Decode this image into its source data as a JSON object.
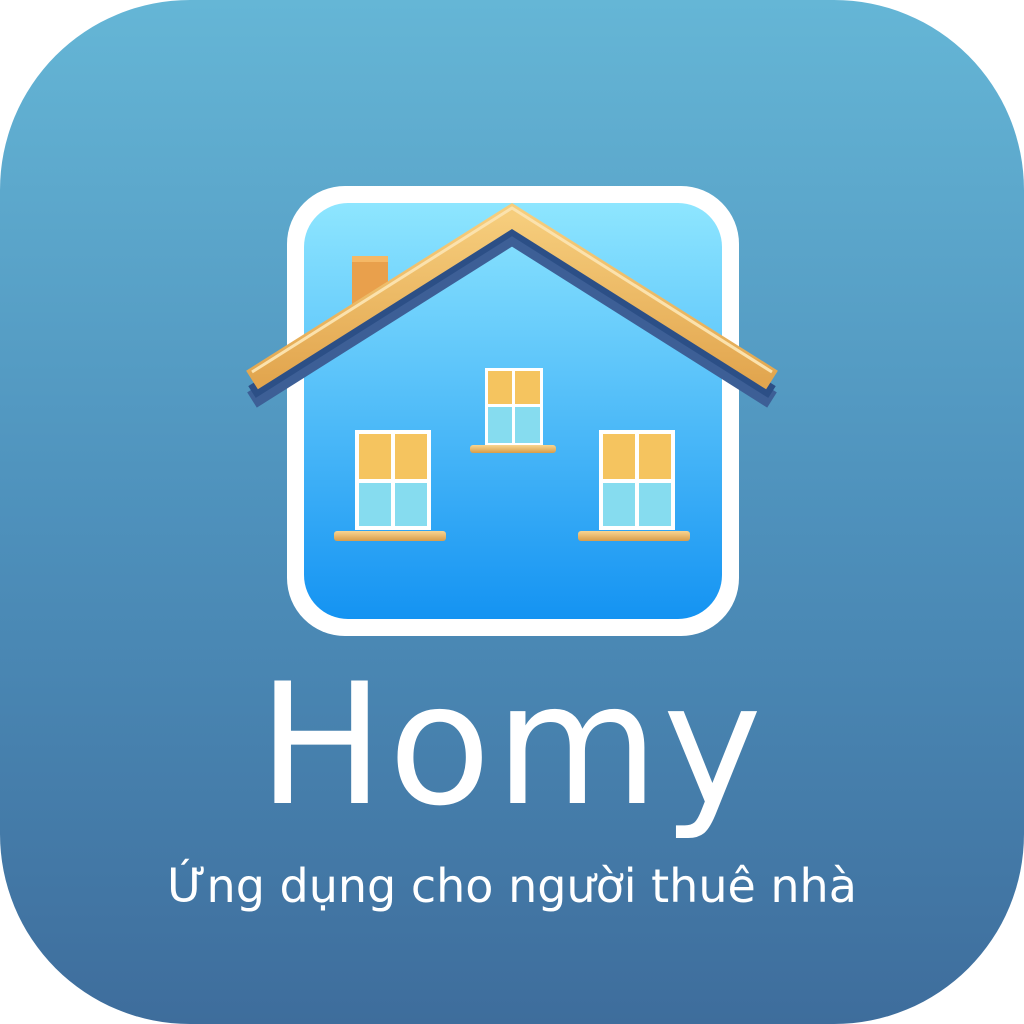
{
  "brand": {
    "name": "Homy",
    "tagline": "Ứng dụng cho người thuê nhà"
  },
  "logo": {
    "icon": "house-icon"
  },
  "colors": {
    "background_top": "#65b6d6",
    "background_bottom": "#3e6d9c",
    "house_sky_top": "#8ee6ff",
    "house_sky_bottom": "#1493f2",
    "roof": "#f2c16c",
    "window_upper": "#f5c45f",
    "window_lower": "#86dcef",
    "chimney": "#e9a04c",
    "text": "#ffffff"
  }
}
